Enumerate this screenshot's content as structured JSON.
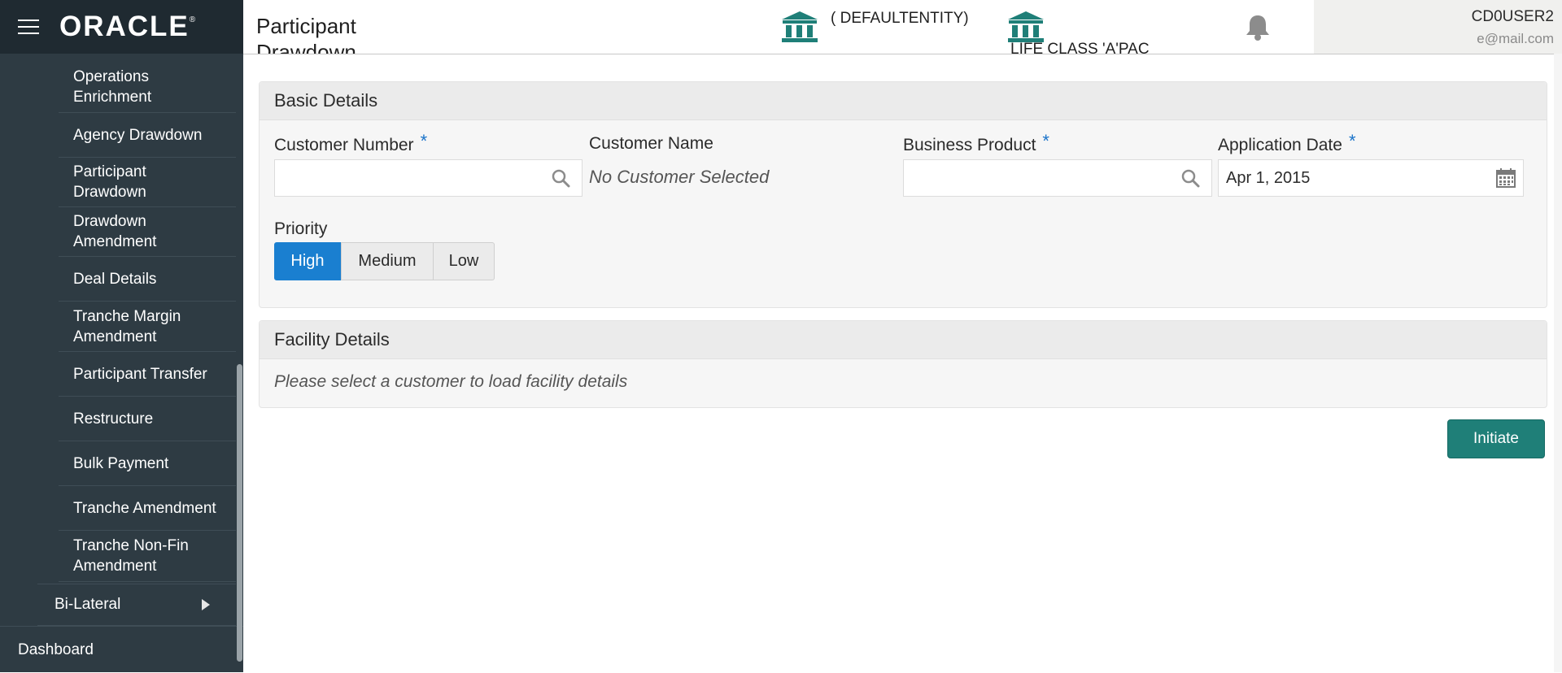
{
  "app": {
    "logo_text": "ORACLE",
    "logo_mark": "®"
  },
  "sidebar": {
    "items": [
      {
        "label": "Operations\nEnrichment"
      },
      {
        "label": "Agency Drawdown"
      },
      {
        "label": "Participant\nDrawdown"
      },
      {
        "label": "Drawdown\nAmendment"
      },
      {
        "label": "Deal Details"
      },
      {
        "label": "Tranche Margin\nAmendment"
      },
      {
        "label": "Participant Transfer"
      },
      {
        "label": "Restructure"
      },
      {
        "label": "Bulk Payment"
      },
      {
        "label": "Tranche Amendment"
      },
      {
        "label": "Tranche Non-Fin\nAmendment"
      }
    ],
    "bilateral_label": "Bi-Lateral",
    "dashboard_label": "Dashboard"
  },
  "header": {
    "page_title": "Participant Drawdown",
    "entity_label": "( DEFAULTENTITY)",
    "entity2_label": "LIFE CLASS 'A'PAC",
    "user_name": "CD0USER2",
    "user_email": "e@mail.com"
  },
  "basic_details": {
    "title": "Basic Details",
    "customer_number_label": "Customer Number",
    "customer_number_value": "",
    "customer_name_label": "Customer Name",
    "customer_name_value": "No Customer Selected",
    "business_product_label": "Business Product",
    "business_product_value": "",
    "application_date_label": "Application Date",
    "application_date_value": "Apr 1, 2015",
    "required_mark": "*",
    "priority_label": "Priority",
    "priority_options": [
      "High",
      "Medium",
      "Low"
    ],
    "priority_selected": "High"
  },
  "facility_details": {
    "title": "Facility Details",
    "message": "Please select a customer to load facility details"
  },
  "actions": {
    "initiate_label": "Initiate"
  },
  "colors": {
    "sidebar_bg": "#2e3b43",
    "accent_blue": "#1a7fd0",
    "teal_button": "#1f7f78",
    "bank_icon": "#1f7f78"
  }
}
